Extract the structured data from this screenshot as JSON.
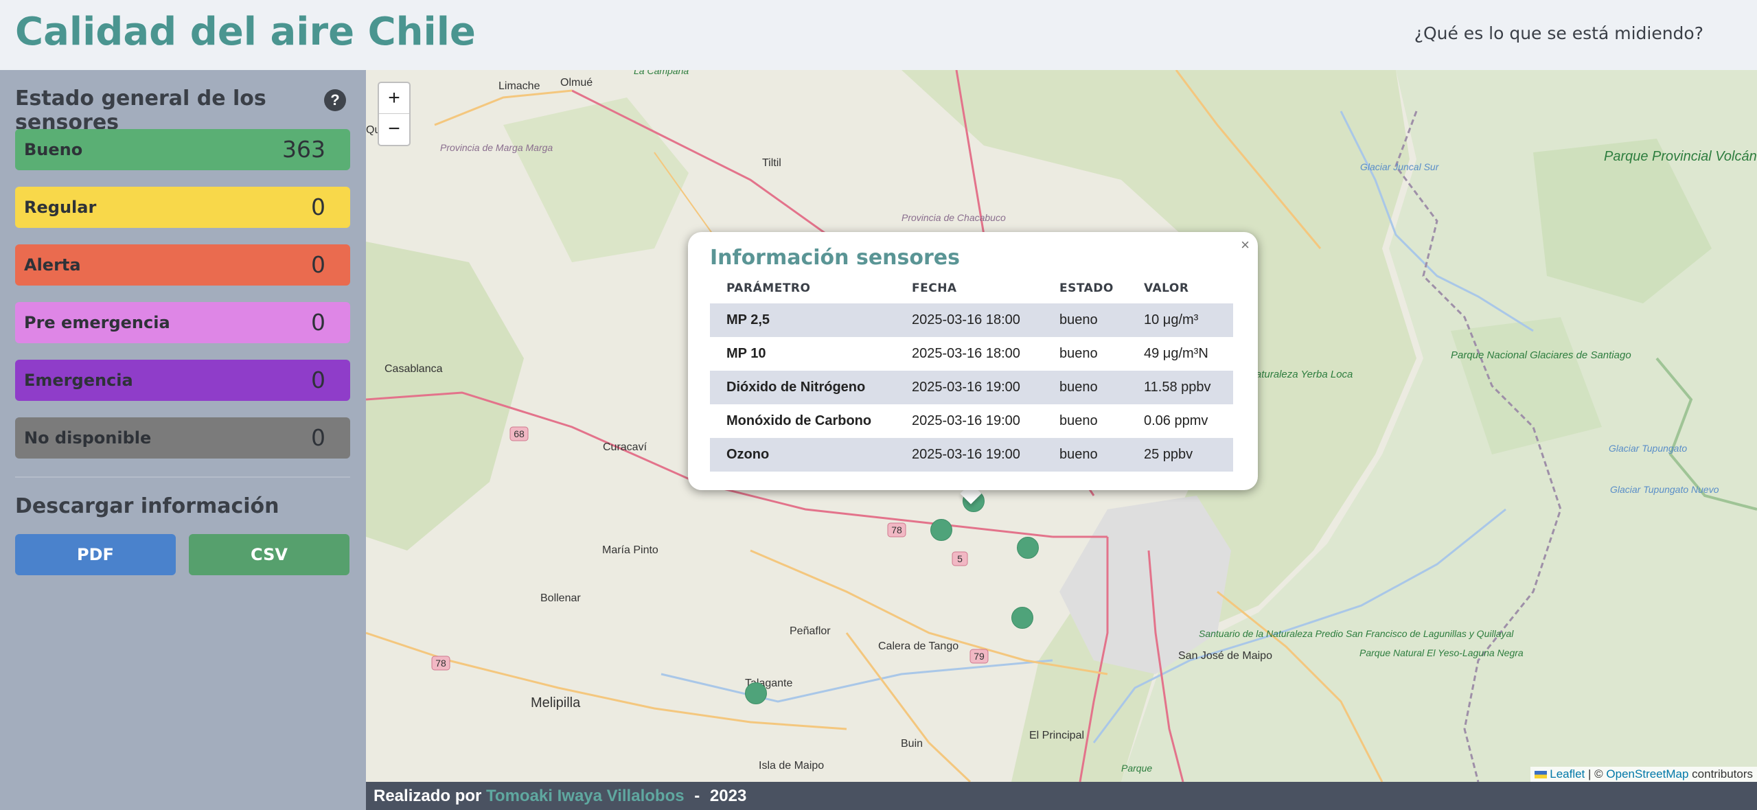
{
  "header": {
    "title": "Calidad del aire Chile",
    "nav_link": "¿Qué es lo que se está midiendo?"
  },
  "sidebar": {
    "title": "Estado general de los sensores",
    "help_icon": "question-circle-icon",
    "statuses": [
      {
        "label": "Bueno",
        "count": "363",
        "color": "#5aaf74"
      },
      {
        "label": "Regular",
        "count": "0",
        "color": "#f8d84a"
      },
      {
        "label": "Alerta",
        "count": "0",
        "color": "#ea6b4f"
      },
      {
        "label": "Pre emergencia",
        "count": "0",
        "color": "#de86e6"
      },
      {
        "label": "Emergencia",
        "count": "0",
        "color": "#8f3dc9"
      },
      {
        "label": "No disponible",
        "count": "0",
        "color": "#7b7b7b"
      }
    ],
    "download_title": "Descargar información",
    "pdf_label": "PDF",
    "csv_label": "CSV",
    "pdf_color": "#4a82cc",
    "csv_color": "#56a06d"
  },
  "map": {
    "zoom_in": "+",
    "zoom_out": "−",
    "labels": [
      "Limache",
      "Olmué",
      "Quilpué",
      "Provincia de Marga Marga",
      "Tiltil",
      "Casablanca",
      "Curacaví",
      "María Pinto",
      "Bollenar",
      "Peñaflor",
      "Calera de Tango",
      "Talagante",
      "Melipilla",
      "Isla de Maipo",
      "Buin",
      "El Principal",
      "San José de Maipo",
      "Parque Provincial Volcán Tupungato",
      "Parque Nacional Glaciares de Santiago",
      "Santuario de la Naturaleza Yerba Loca",
      "Santuario de la Naturaleza Predio San Francisco de Lagunillas y Quillayal",
      "Parque Natural El Yeso-Laguna Negra",
      "Glaciar Juncal Sur",
      "Glaciar Tupungato",
      "Glaciar Tupungato Nuevo",
      "Provincia de Chacabuco",
      "Parque",
      "68",
      "78",
      "5",
      "79",
      "La Campana"
    ],
    "attribution": {
      "leaflet": "Leaflet",
      "separator": "| ©",
      "osm": "OpenStreetMap",
      "contributors": "contributors"
    }
  },
  "popup": {
    "title": "Información sensores",
    "close": "×",
    "headers": [
      "PARÁMETRO",
      "FECHA",
      "ESTADO",
      "VALOR"
    ],
    "rows": [
      {
        "param": "MP 2,5",
        "fecha": "2025-03-16 18:00",
        "estado": "bueno",
        "valor": "10 μg/m³"
      },
      {
        "param": "MP 10",
        "fecha": "2025-03-16 18:00",
        "estado": "bueno",
        "valor": "49 μg/m³N"
      },
      {
        "param": "Dióxido de Nitrógeno",
        "fecha": "2025-03-16 19:00",
        "estado": "bueno",
        "valor": "11.58 ppbv"
      },
      {
        "param": "Monóxido de Carbono",
        "fecha": "2025-03-16 19:00",
        "estado": "bueno",
        "valor": "0.06 ppmv"
      },
      {
        "param": "Ozono",
        "fecha": "2025-03-16 19:00",
        "estado": "bueno",
        "valor": "25 ppbv"
      }
    ]
  },
  "footer": {
    "prefix": "Realizado por",
    "author": "Tomoaki Iwaya Villalobos",
    "separator": "-",
    "year": "2023"
  }
}
